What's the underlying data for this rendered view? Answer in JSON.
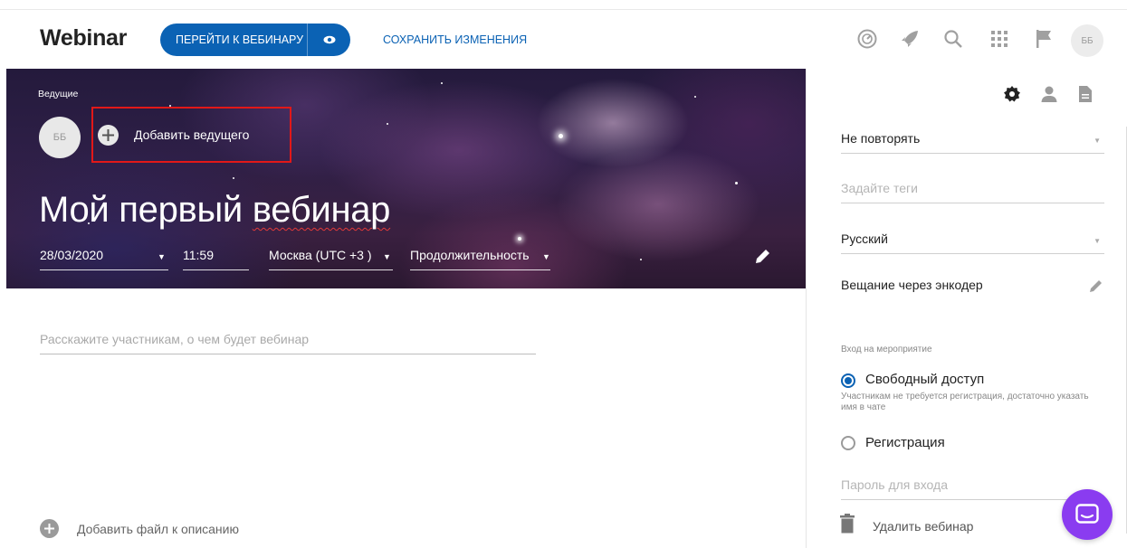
{
  "header": {
    "logo": "Webinar",
    "go_button_label": "ПЕРЕЙТИ К ВЕБИНАРУ",
    "save_label": "СОХРАНИТЬ ИЗМЕНЕНИЯ",
    "avatar_initials": "ББ",
    "icons": [
      "dashboard-icon",
      "rocket-icon",
      "search-icon",
      "apps-grid-icon",
      "flag-icon"
    ]
  },
  "banner": {
    "hosts_label": "Ведущие",
    "host_initials": "ББ",
    "add_host_label": "Добавить ведущего",
    "title_start": "Мой первый ",
    "title_squiggle": "вебинар",
    "date": "28/03/2020",
    "time": "11:59",
    "timezone": "Москва (UTC +3 )",
    "duration": "Продолжительность"
  },
  "main": {
    "description_placeholder": "Расскажите участникам, о чем будет вебинар",
    "add_file_label": "Добавить файл к описанию"
  },
  "panel": {
    "tabs": [
      "settings-icon",
      "person-icon",
      "document-icon"
    ],
    "repeat_value": "Не повторять",
    "tags_placeholder": "Задайте теги",
    "language_value": "Русский",
    "encoder_label": "Вещание через энкодер",
    "access_section_label": "Вход на мероприятие",
    "access_free_label": "Свободный доступ",
    "access_free_hint": "Участникам не требуется регистрация, достаточно указать имя в чате",
    "access_registration_label": "Регистрация",
    "password_placeholder": "Пароль для входа",
    "delete_label": "Удалить вебинар"
  },
  "colors": {
    "accent": "#0b62b4",
    "highlight_box": "#e21818",
    "chat_button": "#8a3cf0"
  }
}
